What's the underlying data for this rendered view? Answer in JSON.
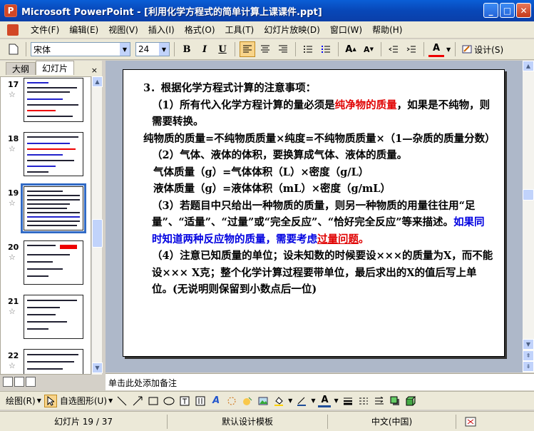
{
  "window": {
    "title": "Microsoft PowerPoint - [利用化学方程式的简单计算上课课件.ppt]",
    "app_icon_letter": "P",
    "controls": {
      "minimize": "_",
      "maximize": "□",
      "close": "✕"
    }
  },
  "menu": [
    "文件(F)",
    "编辑(E)",
    "视图(V)",
    "插入(I)",
    "格式(O)",
    "工具(T)",
    "幻灯片放映(D)",
    "窗口(W)",
    "帮助(H)"
  ],
  "toolbar": {
    "font_name": "宋体",
    "font_size": "24",
    "bold": "B",
    "italic": "I",
    "underline": "U",
    "design_label": "设计(S)"
  },
  "left_panel": {
    "tabs": [
      "大纲",
      "幻灯片"
    ],
    "close": "×",
    "slides": [
      {
        "number": "17",
        "star": "☆"
      },
      {
        "number": "18",
        "star": "☆"
      },
      {
        "number": "19",
        "star": "☆",
        "selected": true
      },
      {
        "number": "20",
        "star": "☆"
      },
      {
        "number": "21",
        "star": "☆"
      },
      {
        "number": "22",
        "star": "☆"
      }
    ]
  },
  "slide": {
    "heading": "3．根据化学方程式计算的注意事项：",
    "p1_a": "（1）所有代入化学方程计算的量必须是",
    "p1_red": "纯净物的质量",
    "p1_b": "，如果是不纯物，则需要转换。",
    "p2": "纯物质的质量=不纯物质质量×纯度=不纯物质质量×（1—杂质的质量分数）",
    "p3": "（2）气体、液体的体积，要换算成气体、液体的质量。",
    "p4": "气体质量（g）=气体体积（L）×密度（g/L）",
    "p5": "液体质量（g）=液体体积（mL）×密度（g/mL）",
    "p6_a": "（3）若题目中只给出一种物质的质量，则另一种物质的用量往往用“足量”、“适量”、“过量”或“完全反应”、“恰好完全反应”等来描述。",
    "p6_blue": "如果同时知道两种反应物的质量，需要考虑",
    "p6_red": "过量问题",
    "p6_end": "。",
    "p7": "（4）注意已知质量的单位；设未知数的时候要设×××的质量为X，而不能设××× X克；整个化学计算过程要带单位，最后求出的X的值后写上单位。(无说明则保留到小数点后一位)"
  },
  "notes_placeholder": "单击此处添加备注",
  "drawing_toolbar": {
    "draw": "绘图(R)",
    "autoshapes": "自选图形(U)"
  },
  "status": {
    "slide_position": "幻灯片 19 / 37",
    "template": "默认设计模板",
    "language": "中文(中国)"
  },
  "colors": {
    "emphasis_red": "#e00000",
    "emphasis_blue": "#0000e0",
    "selection": "#316ac5"
  }
}
